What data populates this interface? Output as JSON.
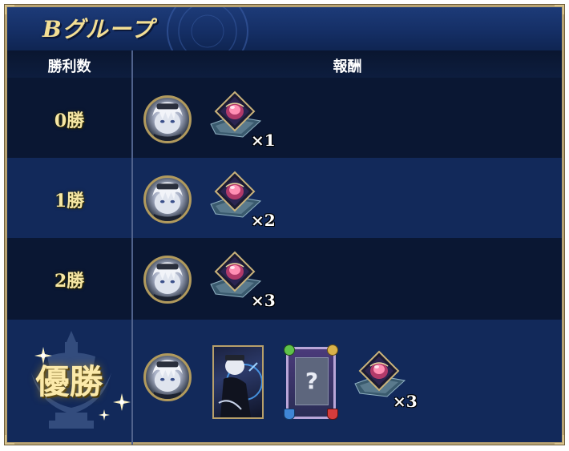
{
  "group_title": "Bグループ",
  "headers": {
    "wins": "勝利数",
    "reward": "報酬"
  },
  "rows": [
    {
      "wins": "0勝",
      "rewards": [
        {
          "type": "avatar"
        },
        {
          "type": "gem",
          "qty": "×1"
        }
      ]
    },
    {
      "wins": "1勝",
      "rewards": [
        {
          "type": "avatar"
        },
        {
          "type": "gem",
          "qty": "×2"
        }
      ]
    },
    {
      "wins": "2勝",
      "rewards": [
        {
          "type": "avatar"
        },
        {
          "type": "gem",
          "qty": "×3"
        }
      ]
    },
    {
      "wins": "優勝",
      "rewards": [
        {
          "type": "avatar"
        },
        {
          "type": "character-card"
        },
        {
          "type": "mystery-card",
          "symbol": "?"
        },
        {
          "type": "gem",
          "qty": "×3"
        }
      ]
    }
  ],
  "colors": {
    "panel": "#0b1c3d",
    "row_light": "#12295a",
    "row_dark": "#0a1733",
    "gold_text": "#f6e7a4",
    "frame": "#b8a373"
  },
  "icons": {
    "avatar": "white-haired-character-avatar-icon",
    "gem": "pink-gem-crystal-icon",
    "card": "character-card-icon",
    "mystery": "question-mark-card-icon",
    "crest": "trophy-crest-icon",
    "spark": "sparkle-icon"
  }
}
